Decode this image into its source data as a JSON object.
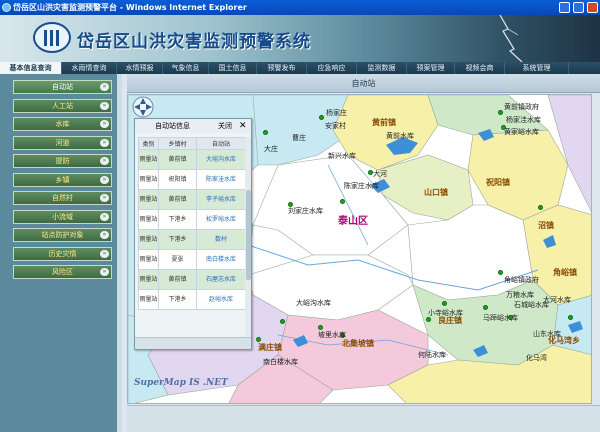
{
  "window": {
    "title": "岱岳区山洪灾害监测预警平台 - Windows Internet Explorer"
  },
  "header": {
    "title": "岱岳区山洪灾害监测预警系统"
  },
  "nav": {
    "tabs": [
      "基本信息查询",
      "水雨情查询",
      "水情预报",
      "气象信息",
      "国土信息",
      "预警发布",
      "应急响应",
      "监测数据",
      "预案管理",
      "视频会商",
      "系统管理"
    ]
  },
  "sidebar": {
    "items": [
      "自动站",
      "人工站",
      "水库",
      "河道",
      "提防",
      "乡镇",
      "自然村",
      "小流域",
      "站点防护对象",
      "历史灾情",
      "风险区"
    ]
  },
  "main": {
    "title": "自动站"
  },
  "popup": {
    "title": "自动站信息",
    "close_label": "关闭",
    "close_symbol": "✕",
    "headers": [
      "类别",
      "乡镇村",
      "自动站"
    ],
    "rows": [
      {
        "type": "雨量站",
        "town": "黄前镇",
        "station": "大峪沟水库"
      },
      {
        "type": "雨量站",
        "town": "祝阳镇",
        "station": "陈家洼水库"
      },
      {
        "type": "雨量站",
        "town": "黄前镇",
        "station": "李子峪水库"
      },
      {
        "type": "雨量站",
        "town": "下港乡",
        "station": "松罗峪水库"
      },
      {
        "type": "雨量站",
        "town": "下港乡",
        "station": "数村"
      },
      {
        "type": "雨量站",
        "town": "夏张",
        "station": "南白楼水库"
      },
      {
        "type": "雨量站",
        "town": "黄前镇",
        "station": "石屋志水库"
      },
      {
        "type": "雨量站",
        "town": "下港乡",
        "station": "赵峪水库"
      }
    ]
  },
  "map": {
    "watermark": "SuperMap IS .NET",
    "towns": [
      "黄前镇",
      "祝阳镇",
      "山口镇",
      "泰山区",
      "角峪镇",
      "良庄镇",
      "满庄镇",
      "北集坡镇",
      "化马湾乡",
      "沼镇"
    ],
    "labels": [
      "黄前镇政府",
      "杨家洼水库",
      "黄家峪水库",
      "大河",
      "陈家庄水库",
      "刘家庄水库",
      "角峪镇政府",
      "石城峪水库",
      "马蹄峪水库",
      "南白楼水库",
      "小寺峪水库",
      "坡里水库",
      "新兴水库",
      "万粮水库",
      "大河水库",
      "大庄",
      "黄前水库",
      "曹庄",
      "安家村",
      "杨家庄",
      "大峪沟水库",
      "何陆水库",
      "化马湾",
      "山东水库"
    ]
  },
  "colors": {
    "nav_bg": "#1c3a4e",
    "sidebar_bg": "#5b8a9c",
    "sidebar_item": "#3f6b43",
    "station_green": "#19a81e",
    "region_yellow": "#f7f0a8",
    "region_pink": "#f4c9dc",
    "region_lavender": "#e2d7f0",
    "region_cyan": "#c7eaf2",
    "region_green": "#cfe9c8",
    "water_blue": "#3f8ed8"
  }
}
